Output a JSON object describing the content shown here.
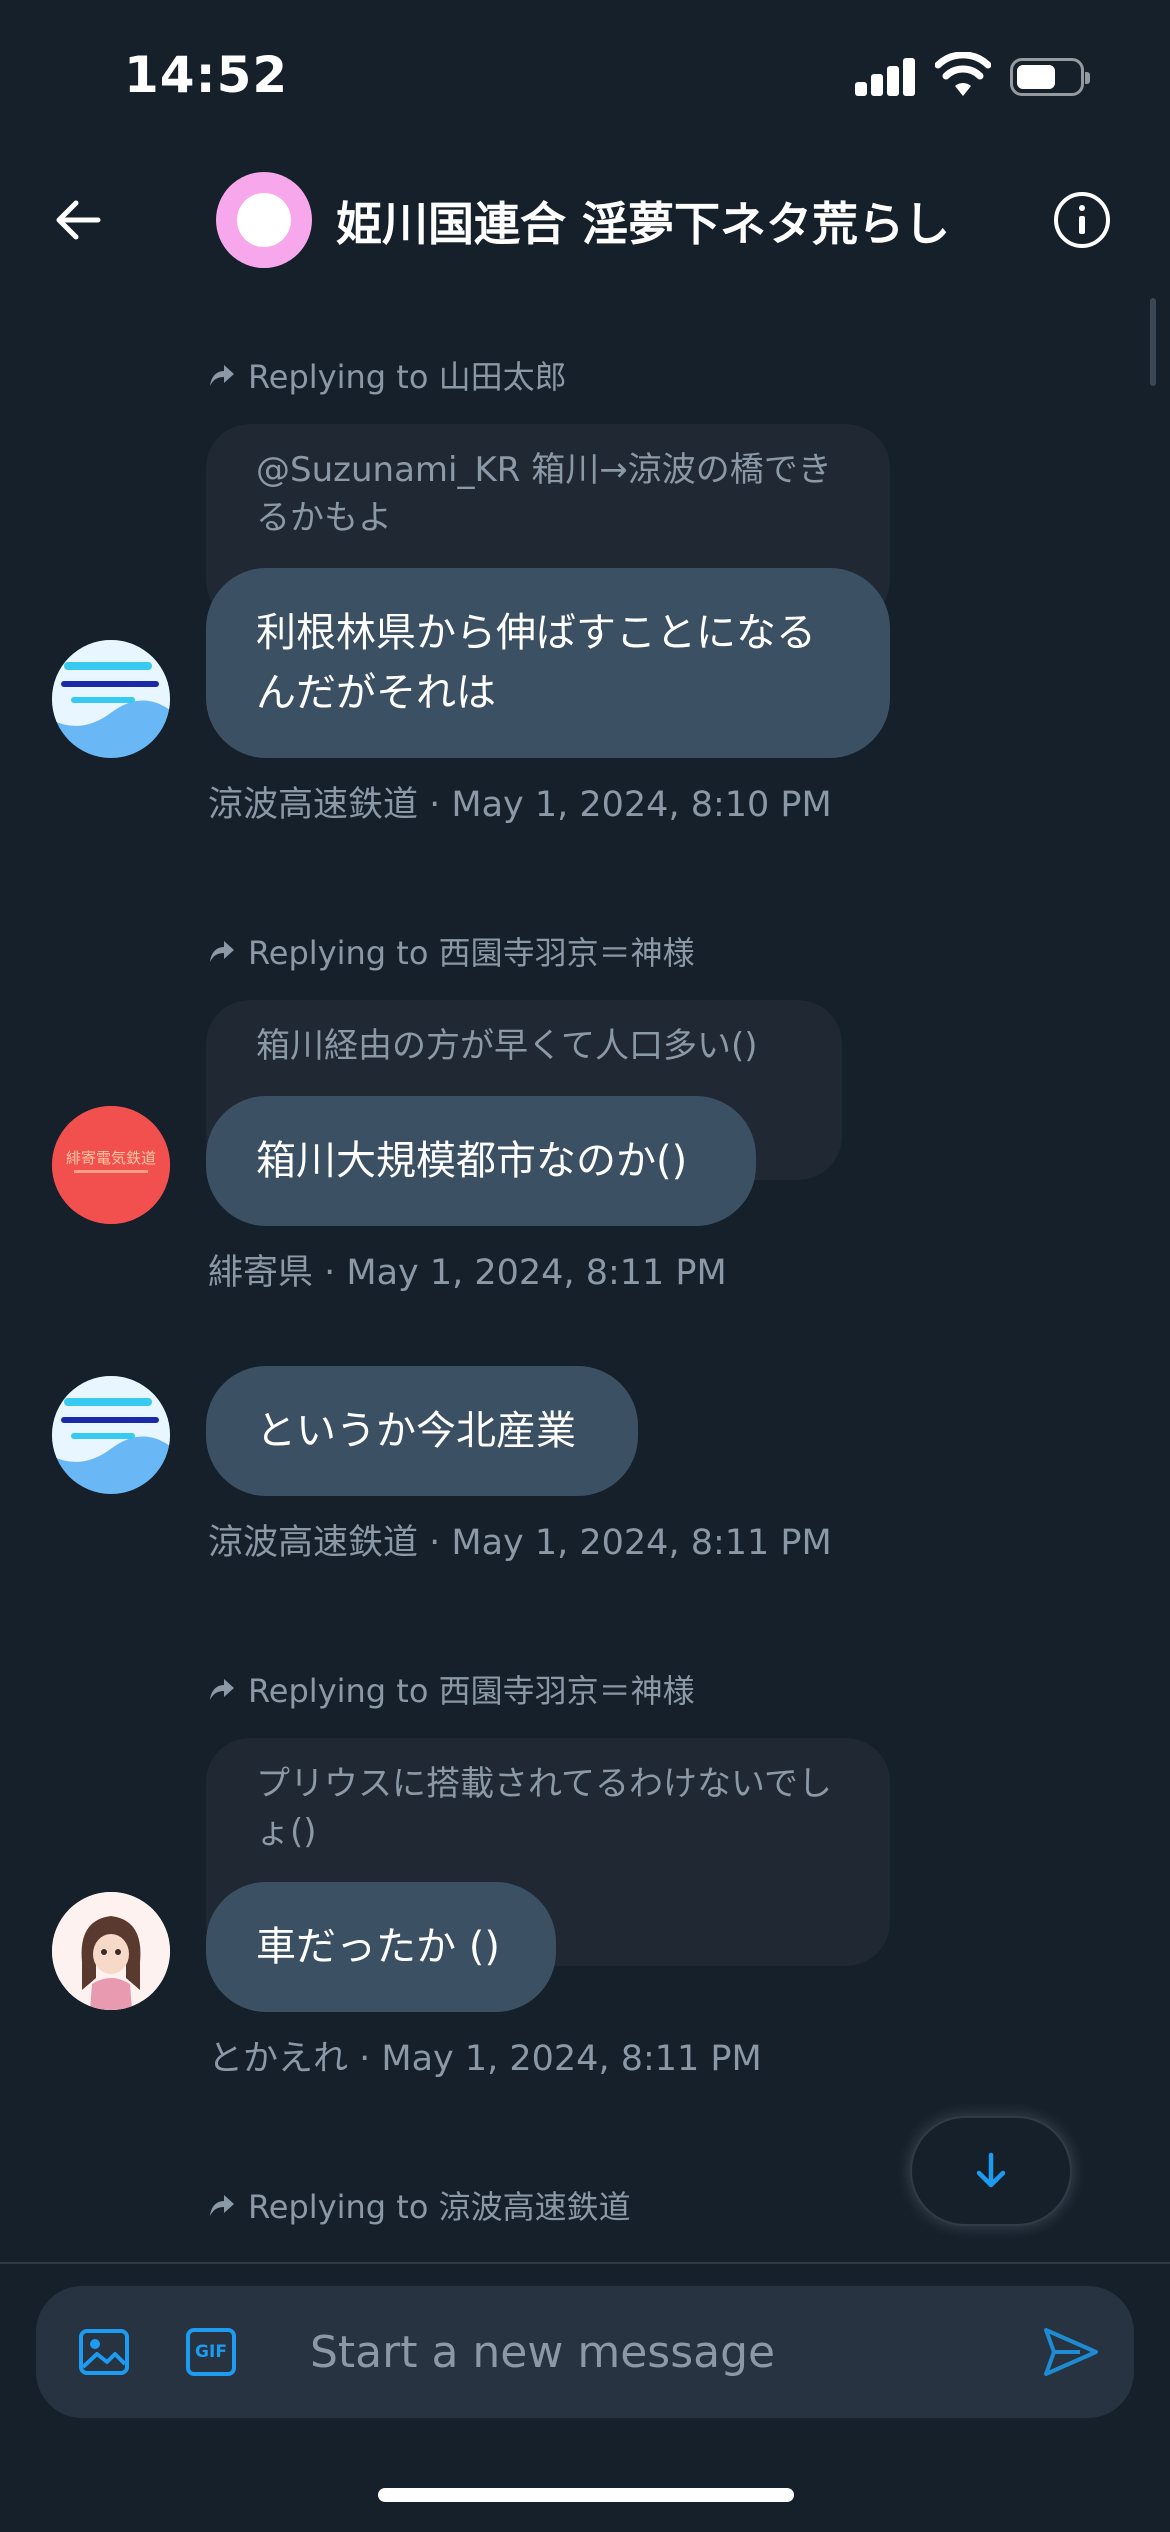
{
  "status_bar": {
    "time": "14:52"
  },
  "header": {
    "title": "姫川国連合 淫夢下ネタ荒らし",
    "back_icon": "arrow-left-icon",
    "info_icon": "info-icon"
  },
  "messages": [
    {
      "reply_to": "Replying to 山田太郎",
      "quoted": "@Suzunami_KR 箱川→涼波の橋できるかもよ",
      "text": "利根林県から伸ばすことになるんだがそれは",
      "sender": "涼波高速鉄道",
      "timestamp": "May 1, 2024, 8:10 PM",
      "meta": "涼波高速鉄道 · May 1, 2024, 8:10 PM"
    },
    {
      "reply_to": "Replying to 西園寺羽京＝神様",
      "quoted": "箱川経由の方が早くて人口多い()",
      "text": "箱川大規模都市なのか()",
      "sender": "緋寄県",
      "timestamp": "May 1, 2024, 8:11 PM",
      "meta": "緋寄県 · May 1, 2024, 8:11 PM",
      "avatar_text": "緋寄電気鉄道"
    },
    {
      "text": "というか今北産業",
      "sender": "涼波高速鉄道",
      "timestamp": "May 1, 2024, 8:11 PM",
      "meta": "涼波高速鉄道 · May 1, 2024, 8:11 PM"
    },
    {
      "reply_to": "Replying to 西園寺羽京＝神様",
      "quoted": "プリウスに搭載されてるわけないでしょ()",
      "text": "車だったか ()",
      "sender": "とかえれ",
      "timestamp": "May 1, 2024, 8:11 PM",
      "meta": "とかえれ · May 1, 2024, 8:11 PM"
    },
    {
      "reply_to": "Replying to 涼波高速鉄道"
    }
  ],
  "composer": {
    "placeholder": "Start a new message",
    "image_icon": "image-icon",
    "gif_label": "GIF",
    "send_icon": "send-icon"
  },
  "colors": {
    "background": "#15202b",
    "bubble": "#3b5063",
    "quote": "#1f2833",
    "accent": "#1d9bf0",
    "muted_text": "#8b98a5"
  }
}
